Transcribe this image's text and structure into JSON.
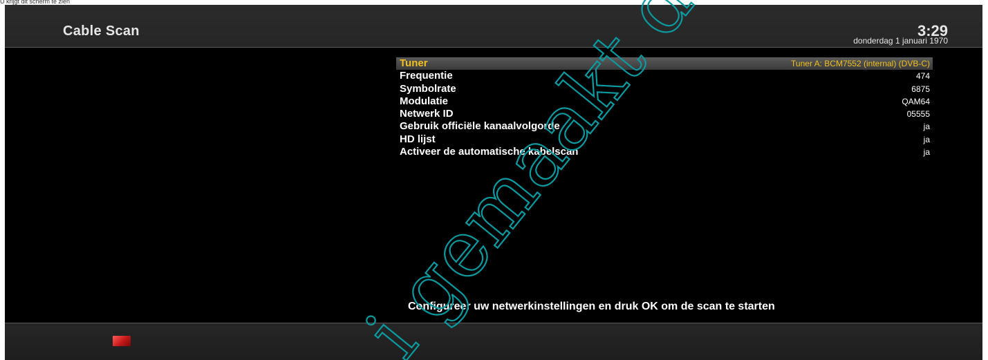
{
  "caption": "U krijgt dit scherm te zien",
  "header": {
    "title": "Cable Scan",
    "time": "3:29",
    "date": "donderdag 1 januari 1970"
  },
  "menu": [
    {
      "label": "Tuner",
      "value": "Tuner A: BCM7552 (internal) (DVB-C)",
      "selected": true
    },
    {
      "label": "Frequentie",
      "value": "474"
    },
    {
      "label": "Symbolrate",
      "value": "6875"
    },
    {
      "label": "Modulatie",
      "value": "QAM64"
    },
    {
      "label": "Netwerk ID",
      "value": "05555"
    },
    {
      "label": "Gebruik officiële kanaalvolgorde",
      "value": "ja"
    },
    {
      "label": "HD lijst",
      "value": "ja"
    },
    {
      "label": "Activeer de automatische kabelscan",
      "value": "ja"
    }
  ],
  "hint": "Configureer uw netwerkinstellingen en druk OK om de scan te starten",
  "watermark": "i gemaakt d",
  "colors": {
    "background": "#000000",
    "header_bg": "#2b2b2b",
    "selected_text": "#f0c020",
    "watermark": "#0a9aa0",
    "red_key": "#d02020"
  },
  "icons": {
    "red_key": "red-color-key-icon"
  }
}
